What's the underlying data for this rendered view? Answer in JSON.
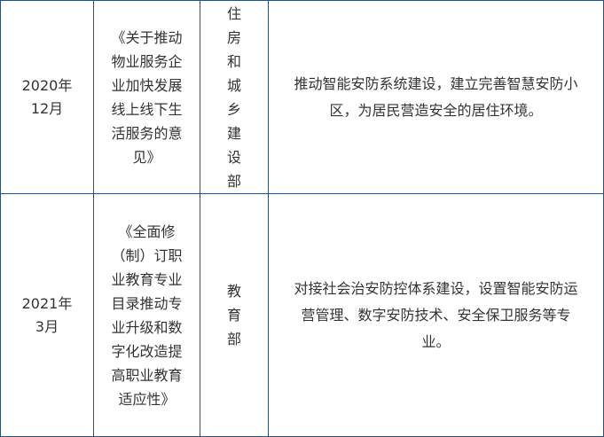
{
  "table": {
    "rows": [
      {
        "date": "2020年12月",
        "document": "《关于推动物业服务企业加快发展线上线下生活服务的意见》",
        "department": "住房和城乡建设部",
        "content": "推动智能安防系统建设，建立完善智慧安防小区，为居民营造安全的居住环境。"
      },
      {
        "date": "2021年3月",
        "document": "《全面修（制）订职业教育专业目录推动专业升级和数字化改造提高职业教育适应性》",
        "department": "教育部",
        "content": "对接社会治安防控体系建设，设置智能安防运营管理、数字安防技术、安全保卫服务等专业。"
      }
    ]
  }
}
